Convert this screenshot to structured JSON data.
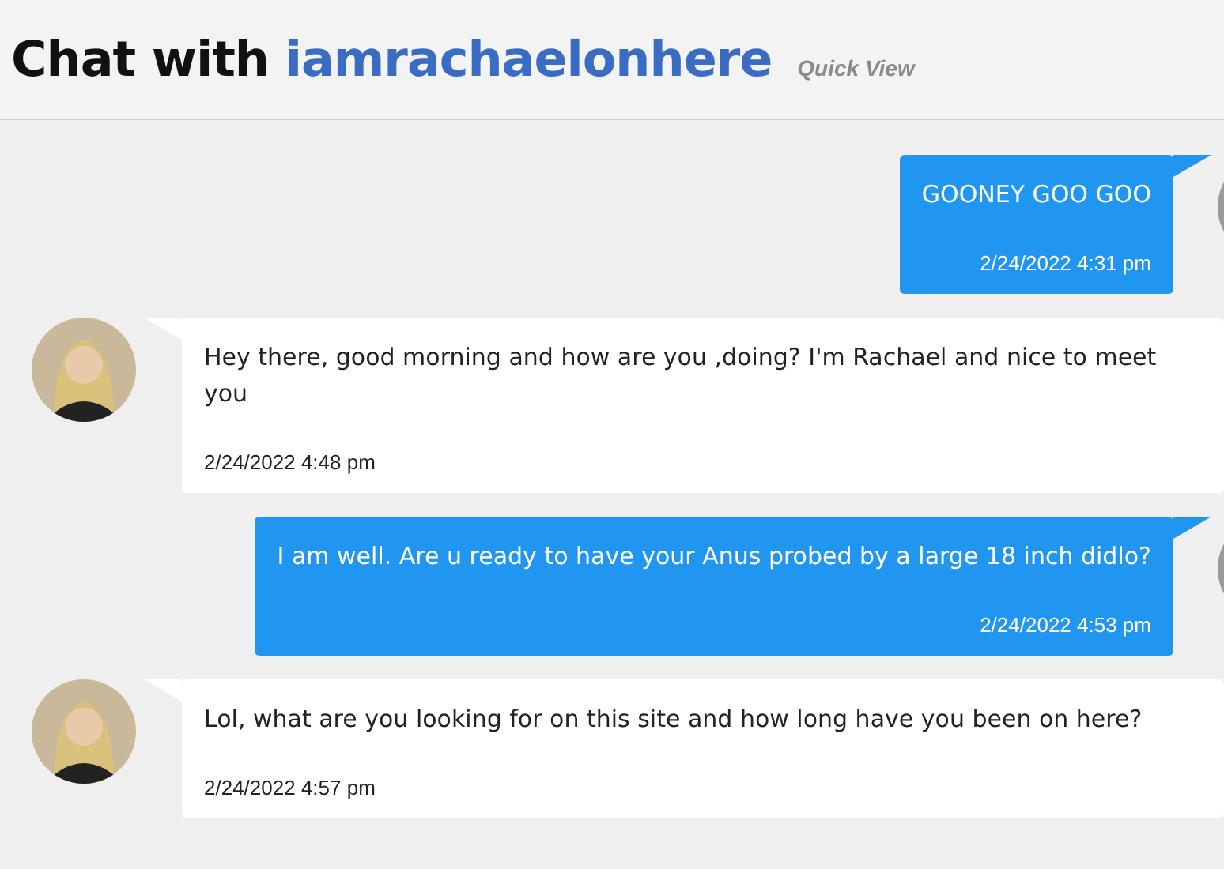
{
  "header": {
    "prefix": "Chat with",
    "username": "iamrachaelonhere",
    "link": "Quick View"
  },
  "messages": [
    {
      "kind": "sent",
      "text": "GOONEY GOO GOO",
      "time": "2/24/2022 4:31 pm"
    },
    {
      "kind": "received",
      "text": "Hey there, good morning and how are you ,doing? I'm Rachael and nice to meet you",
      "time": "2/24/2022 4:48 pm"
    },
    {
      "kind": "sent",
      "text": "I am well. Are u ready to have your Anus probed by a large 18 inch didlo?",
      "time": "2/24/2022 4:53 pm"
    },
    {
      "kind": "received",
      "text": "Lol, what are you looking for on this site and how long have you been on here?",
      "time": "2/24/2022 4:57 pm"
    }
  ]
}
